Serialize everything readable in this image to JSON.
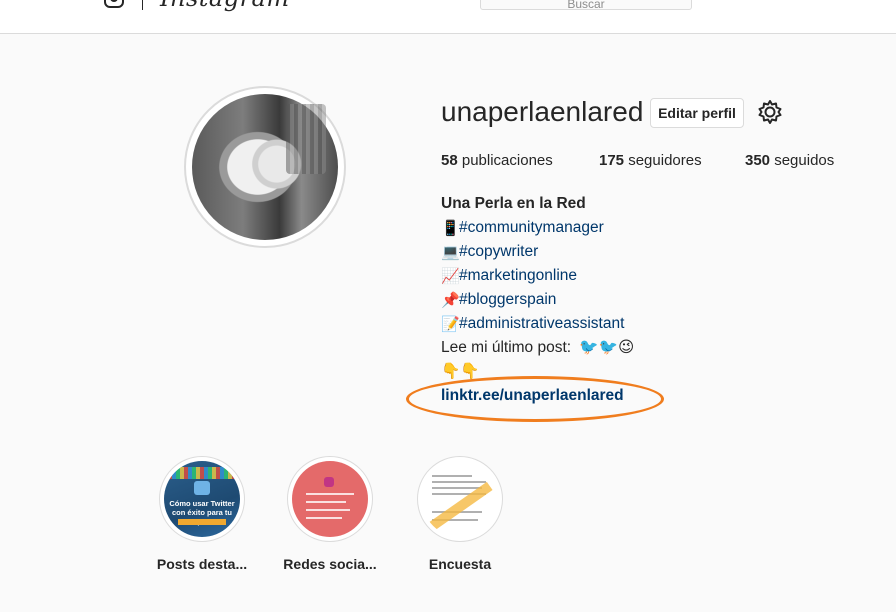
{
  "topbar": {
    "wordmark": "Instagram",
    "search_placeholder": "Buscar"
  },
  "profile": {
    "username": "unaperlaenlared",
    "edit_button": "Editar perfil",
    "stats": [
      {
        "count": "58",
        "label": "publicaciones"
      },
      {
        "count": "175",
        "label": "seguidores"
      },
      {
        "count": "350",
        "label": "seguidos"
      }
    ]
  },
  "bio": {
    "name": "Una Perla en la Red",
    "lines": [
      {
        "icon": "📱",
        "icon_name": "mobile-phone-icon",
        "text": "#communitymanager"
      },
      {
        "icon": "💻",
        "icon_name": "laptop-icon",
        "text": "#copywriter"
      },
      {
        "icon": "📈",
        "icon_name": "chart-icon",
        "text": "#marketingonline"
      },
      {
        "icon": "📌",
        "icon_name": "pushpin-icon",
        "text": "#bloggerspain"
      },
      {
        "icon": "📝",
        "icon_name": "memo-icon",
        "text": "#administrativeassistant"
      }
    ],
    "post_line": "Lee mi último post:",
    "post_emojis": "🐦🐦😉",
    "pointing_emojis": "👇👇",
    "link": "linktr.ee/unaperlaenlared"
  },
  "highlights": [
    {
      "label": "Posts desta...",
      "cover_text": "Cómo usar Twitter con éxito para tu empresa"
    },
    {
      "label": "Redes socia..."
    },
    {
      "label": "Encuesta"
    }
  ],
  "colors": {
    "background": "#fafafa",
    "text": "#262626",
    "link": "#00376b",
    "annotation": "#f07d1e",
    "border": "#dbdbdb"
  }
}
